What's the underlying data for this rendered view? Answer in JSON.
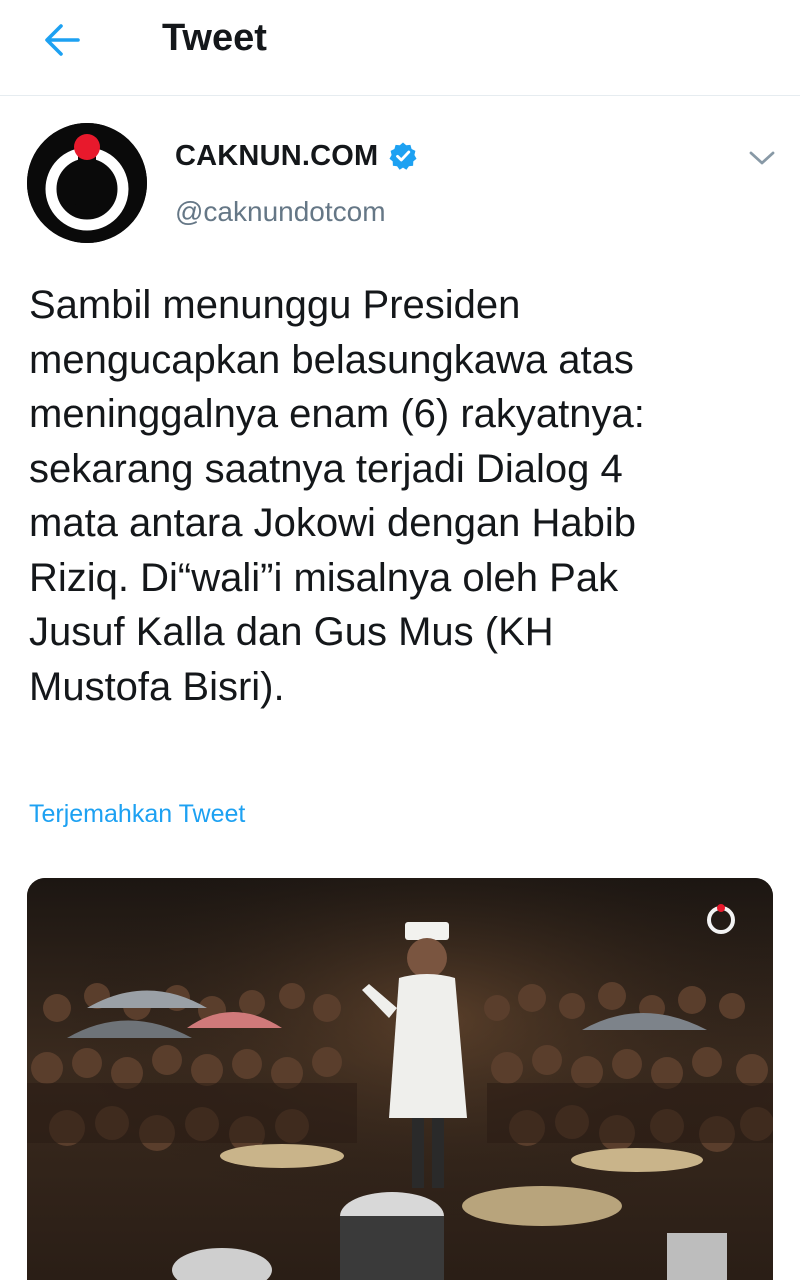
{
  "header": {
    "title": "Tweet",
    "back_icon": "arrow-left-icon"
  },
  "author": {
    "name": "CAKNUN.COM",
    "handle": "@caknundotcom",
    "verified": true,
    "avatar_colors": {
      "background": "#0a0a0a",
      "ring": "#ffffff",
      "dot": "#e8192c"
    }
  },
  "menu": {
    "icon": "chevron-down-icon"
  },
  "tweet": {
    "text": "Sambil menunggu Presiden\nmengucapkan belasungkawa atas\nmeninggalnya enam (6) rakyatnya:\nsekarang saatnya terjadi Dialog 4\nmata antara Jokowi dengan Habib\nRiziq. Di“wali”i misalnya oleh Pak\nJusuf Kalla dan Gus Mus (KH\nMustofa Bisri).",
    "translate_label": "Terjemahkan Tweet"
  },
  "media": {
    "watermark": "CAKNUN"
  },
  "colors": {
    "accent": "#1da1f2",
    "text": "#14171a",
    "secondary_text": "#657786",
    "divider": "#e6ecf0"
  }
}
